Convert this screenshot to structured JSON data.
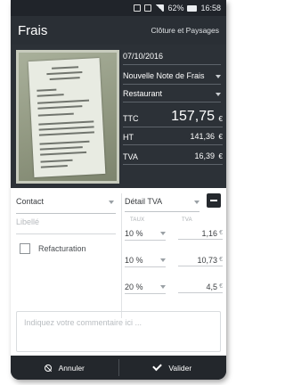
{
  "status_bar": {
    "battery_percent": "62%",
    "time": "16:58"
  },
  "app_bar": {
    "title": "Frais",
    "action": "Clôture et Paysages"
  },
  "expense": {
    "date": "07/10/2016",
    "note": "Nouvelle Note de Frais",
    "category": "Restaurant",
    "ttc_label": "TTC",
    "ttc_value": "157,75",
    "ttc_currency": "€",
    "ht_label": "HT",
    "ht_value": "141,36",
    "ht_currency": "€",
    "tva_label": "TVA",
    "tva_value": "16,39",
    "tva_currency": "€"
  },
  "form": {
    "contact_label": "Contact",
    "libelle_placeholder": "Libellé",
    "refacturation_label": "Refacturation",
    "tva_detail_label": "Détail TVA",
    "col_rate": "TAUX",
    "col_tva": "TVA",
    "tva_lines": [
      {
        "rate": "10 %",
        "amount": "1,16",
        "currency": "€"
      },
      {
        "rate": "10 %",
        "amount": "10,73",
        "currency": "€"
      },
      {
        "rate": "20 %",
        "amount": "4,5",
        "currency": "€"
      }
    ],
    "comment_placeholder": "Indiquez votre commentaire ici ..."
  },
  "bottom_bar": {
    "cancel_label": "Annuler",
    "confirm_label": "Valider"
  },
  "icons": {
    "status": [
      "vibrate-icon",
      "network-icon",
      "signal-icon",
      "battery-icon"
    ],
    "dropdown": "chevron-down-icon",
    "remove": "minus-icon",
    "cancel": "cancel-icon",
    "confirm": "check-icon"
  }
}
